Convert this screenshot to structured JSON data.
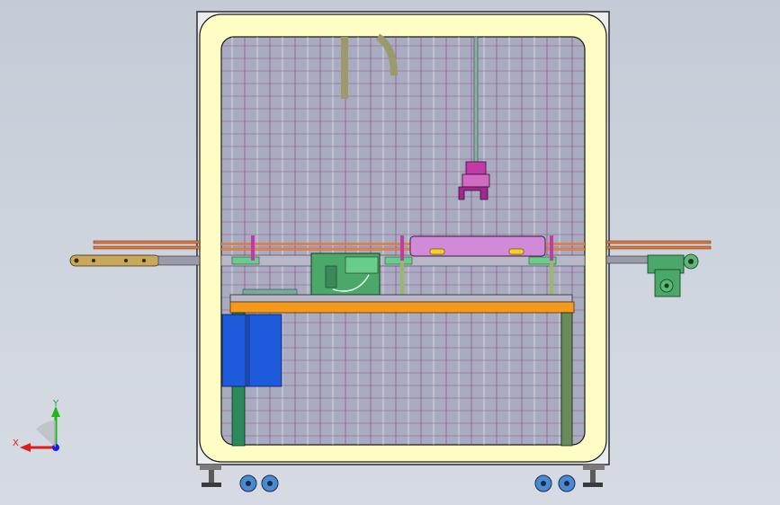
{
  "app": {
    "window_title": ""
  },
  "viewport": {
    "background_top": "#c4cbd6",
    "background_bottom": "#d6dbe3"
  },
  "model": {
    "view": "Front",
    "frame_color": "#fdfdc4",
    "frame_outline": "#2a2a2a",
    "grid_color_major": "#ffffff",
    "grid_color_minor": "#8a2a7a",
    "rail_color": "#e07a3a",
    "table_color": "#f59a1a",
    "leg_color": "#2a8a5a",
    "blue_box_color": "#1e5bdc",
    "bin_color": "#d08ad8",
    "gripper_color": "#c23aa8",
    "green_plate_color": "#4aa86a",
    "caster_color": "#4a8ad0"
  },
  "triad": {
    "x_label": "X",
    "y_label": "Y",
    "x_color": "#e01c1c",
    "y_color": "#1cb81c",
    "z_color": "#1c1ce0"
  }
}
